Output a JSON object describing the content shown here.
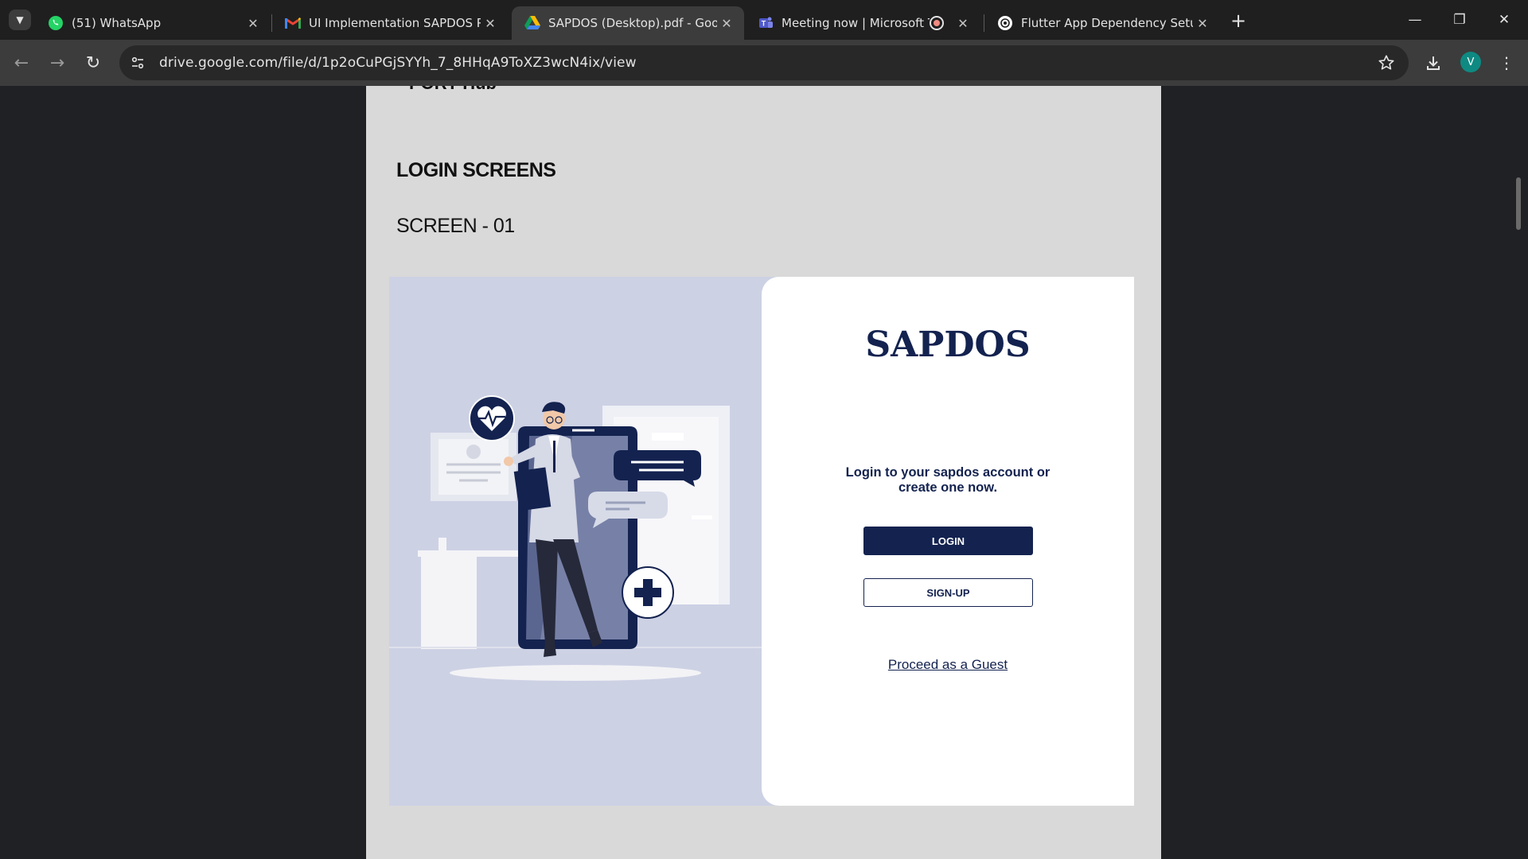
{
  "browser": {
    "tabs": [
      {
        "title": "(51) WhatsApp",
        "icon": "whatsapp-icon"
      },
      {
        "title": "UI Implementation SAPDOS Pro",
        "icon": "gmail-icon"
      },
      {
        "title": "SAPDOS (Desktop).pdf - Google",
        "icon": "google-drive-icon",
        "active": true
      },
      {
        "title": "Meeting now | Microsoft Te",
        "icon": "teams-icon"
      },
      {
        "title": "Flutter App Dependency Setup",
        "icon": "chatgpt-icon"
      }
    ],
    "url": "drive.google.com/file/d/1p2oCuPGjSYYh_7_8HHqA9ToXZ3wcN4ix/view",
    "profile_initial": "V"
  },
  "document": {
    "cut_text": "PORT Hub",
    "heading": "LOGIN SCREENS",
    "subheading": "SCREEN - 01"
  },
  "mockup": {
    "brand": "SAPDOS",
    "tagline": "Login to your sapdos account or create one now.",
    "login_label": "LOGIN",
    "signup_label": "SIGN-UP",
    "guest_label": "Proceed as a Guest"
  },
  "colors": {
    "navy": "#13224f",
    "illustration_bg": "#cdd1e4",
    "page_bg": "#d9d9d9",
    "profile": "#0e8a82"
  }
}
